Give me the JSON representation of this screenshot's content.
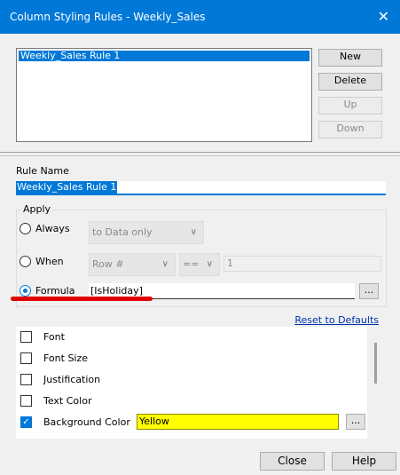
{
  "window": {
    "title": "Column Styling Rules - Weekly_Sales",
    "close_glyph": "✕"
  },
  "rules": {
    "items": [
      "Weekly_Sales Rule 1"
    ]
  },
  "side_buttons": {
    "new": "New",
    "delete": "Delete",
    "up": "Up",
    "down": "Down"
  },
  "rule_name": {
    "label": "Rule Name",
    "value": "Weekly_Sales Rule 1"
  },
  "apply": {
    "label": "Apply",
    "always": {
      "label": "Always",
      "combo_value": "to Data only"
    },
    "when": {
      "label": "When",
      "column_value": "Row #",
      "operator_value": "==",
      "operand_value": "1"
    },
    "formula": {
      "label": "Formula",
      "value": "[IsHoliday]",
      "browse_label": "..."
    }
  },
  "reset_link": "Reset to Defaults",
  "properties": {
    "font": "Font",
    "font_size": "Font Size",
    "justification": "Justification",
    "text_color": "Text Color",
    "background_color": {
      "label": "Background Color",
      "value": "Yellow",
      "browse_label": "..."
    }
  },
  "footer": {
    "close": "Close",
    "help": "Help"
  },
  "colors": {
    "accent": "#0078d7",
    "highlight": "#ffff00",
    "annotation": "#e00000"
  }
}
